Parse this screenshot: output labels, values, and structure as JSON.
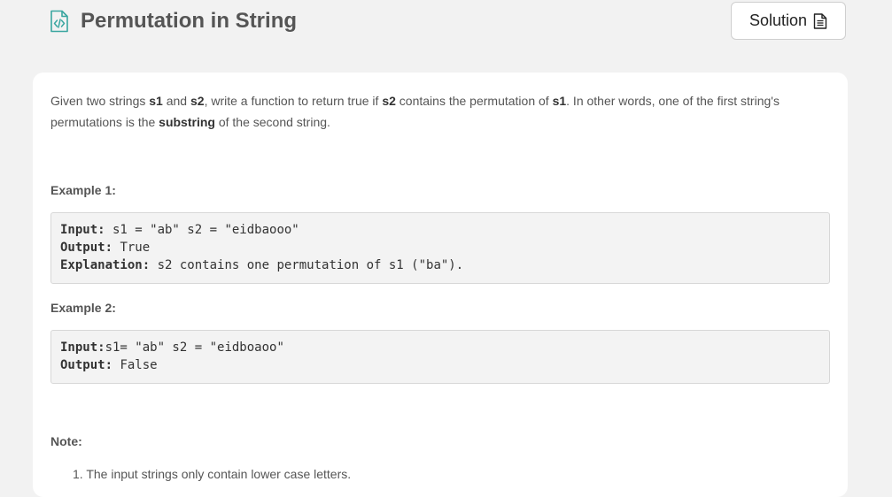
{
  "header": {
    "title": "Permutation in String",
    "solution_label": "Solution"
  },
  "description": {
    "t1": "Given two strings ",
    "s1": "s1",
    "t2": " and ",
    "s2": "s2",
    "t3": ", write a function to return true if ",
    "s2b": "s2",
    "t4": " contains the permutation of ",
    "s1b": "s1",
    "t5": ". In other words, one of the first string's permutations is the ",
    "substring": "substring",
    "t6": " of the second string."
  },
  "example1": {
    "heading": "Example 1:",
    "input_key": "Input:",
    "input_val": " s1 = \"ab\" s2 = \"eidbaooo\"",
    "output_key": "Output:",
    "output_val": " True",
    "explanation_key": "Explanation:",
    "explanation_val": " s2 contains one permutation of s1 (\"ba\")."
  },
  "example2": {
    "heading": "Example 2:",
    "input_key": "Input:",
    "input_val": "s1= \"ab\" s2 = \"eidboaoo\"",
    "output_key": "Output:",
    "output_val": " False"
  },
  "note": {
    "heading": "Note:",
    "items": [
      {
        "num": "1.",
        "text": "The input strings only contain lower case letters."
      }
    ]
  },
  "colors": {
    "accent_icon": "#3aa6a0",
    "page_bg": "#f2f2f2",
    "card_bg": "#ffffff",
    "code_bg": "#f3f3f3"
  },
  "icons": {
    "title_icon": "code-file-icon",
    "solution_icon": "document-icon"
  }
}
